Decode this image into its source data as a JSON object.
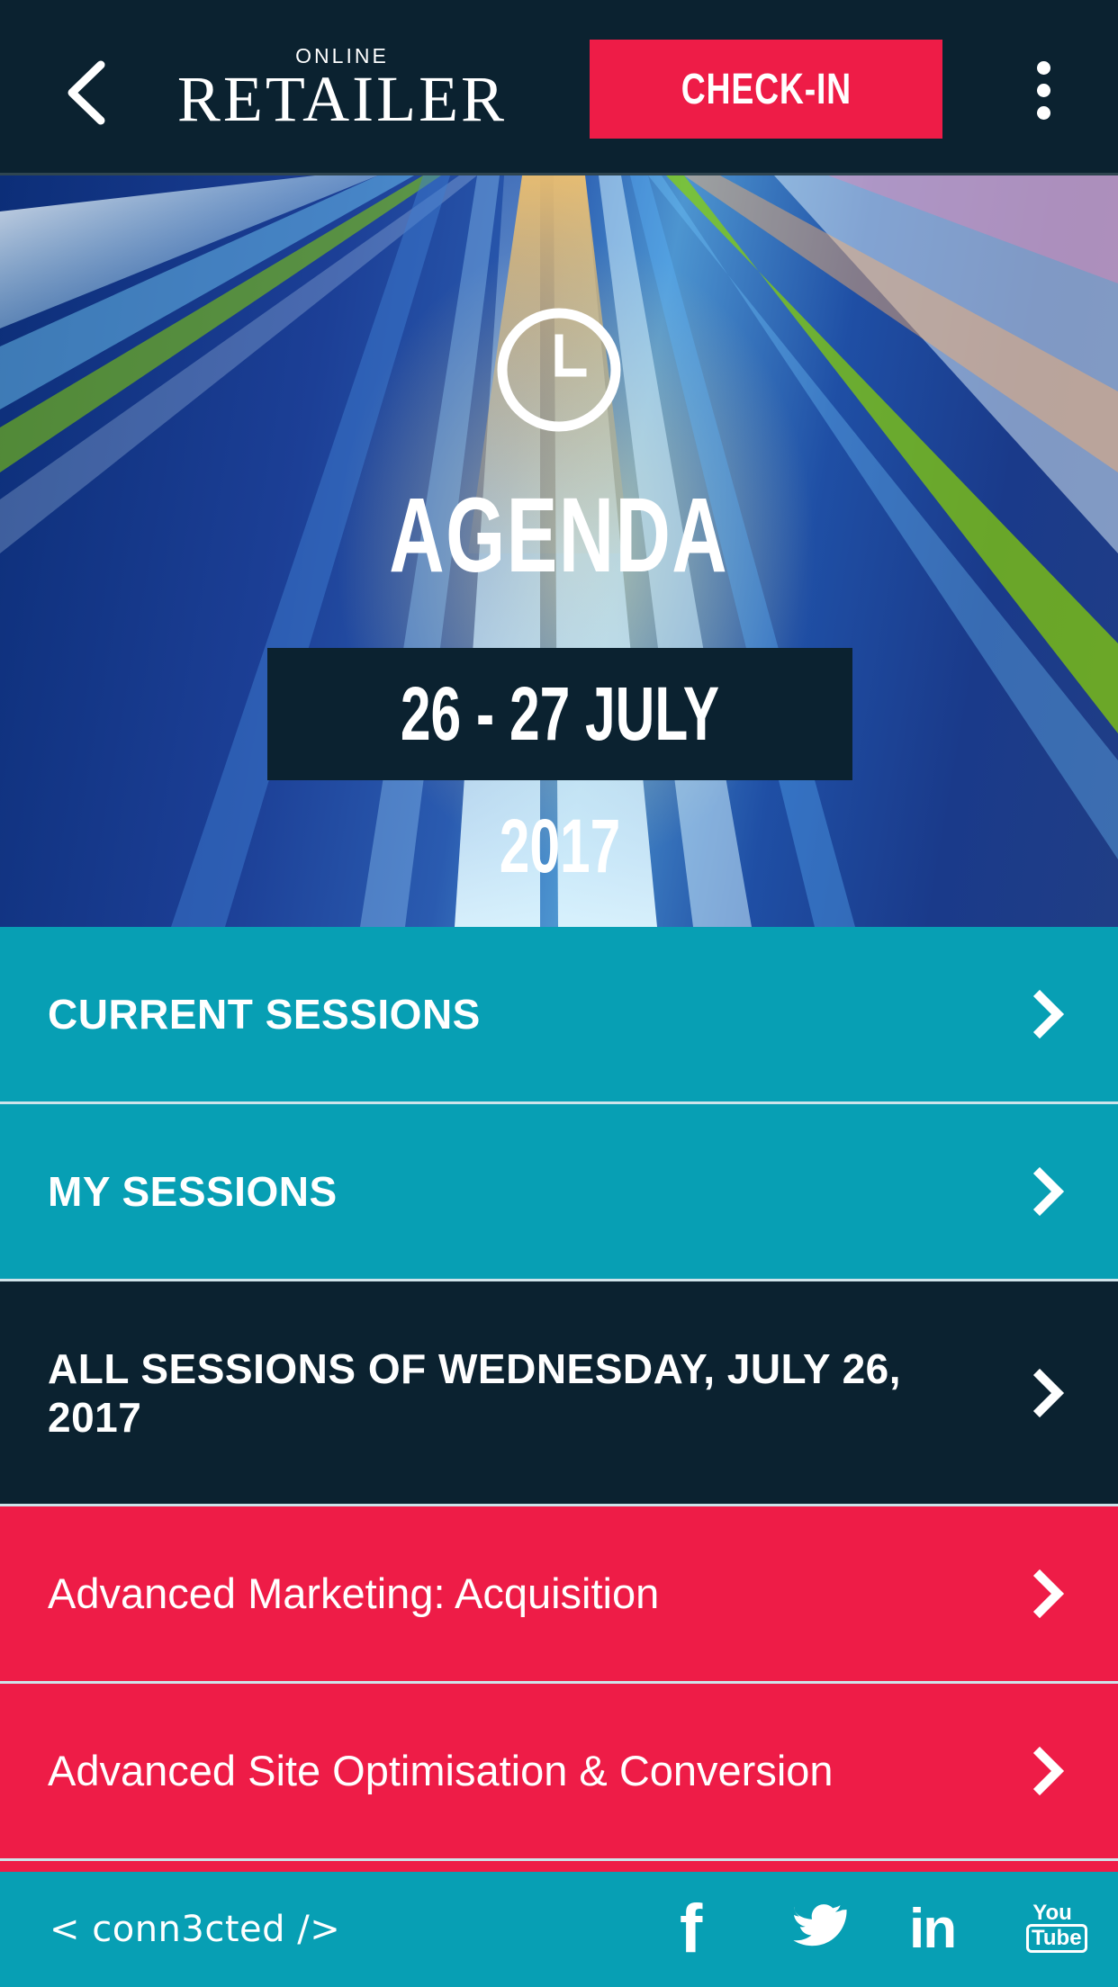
{
  "header": {
    "logo_top": "ONLINE",
    "logo_main": "RETAILER",
    "checkin_label": "CHECK-IN",
    "back_icon": "back-arrow-icon",
    "more_icon": "more-vertical-icon"
  },
  "hero": {
    "icon": "clock-icon",
    "title": "AGENDA",
    "date_range": "26 - 27 JULY 2017"
  },
  "menu": {
    "items": [
      {
        "label": "CURRENT SESSIONS",
        "style": "teal"
      },
      {
        "label": "MY SESSIONS",
        "style": "teal"
      },
      {
        "label": "ALL SESSIONS OF WEDNESDAY, JULY 26, 2017",
        "style": "dark"
      },
      {
        "label": "Advanced Marketing: Acquisition",
        "style": "red"
      },
      {
        "label": "Advanced Site Optimisation & Conversion",
        "style": "red"
      }
    ]
  },
  "footer": {
    "brand": "< conn3cted />",
    "social": [
      "facebook-icon",
      "twitter-icon",
      "linkedin-icon",
      "youtube-icon"
    ],
    "youtube_top": "You",
    "youtube_bottom": "Tube"
  },
  "colors": {
    "dark": "#0b2230",
    "teal": "#079fb4",
    "red": "#ee1c47",
    "white": "#ffffff"
  }
}
